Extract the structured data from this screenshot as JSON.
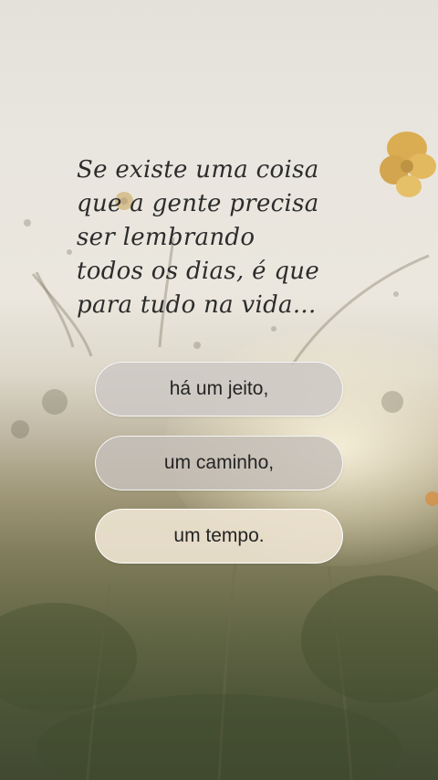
{
  "quote": {
    "lines": [
      "Se existe uma coisa",
      "que a gente precisa",
      "ser lembrando",
      "todos os dias, é  que",
      "para tudo na vida..."
    ]
  },
  "options": [
    {
      "label": "há um jeito,"
    },
    {
      "label": "um caminho,"
    },
    {
      "label": "um tempo."
    }
  ],
  "icons": {
    "background": "blurred-wildflower-meadow-photo",
    "flower": "yellow-cosmos-flower"
  },
  "colors": {
    "text": "#2c2c2c",
    "option_text": "#242424",
    "selected_option_bg": "#ece2d0"
  }
}
